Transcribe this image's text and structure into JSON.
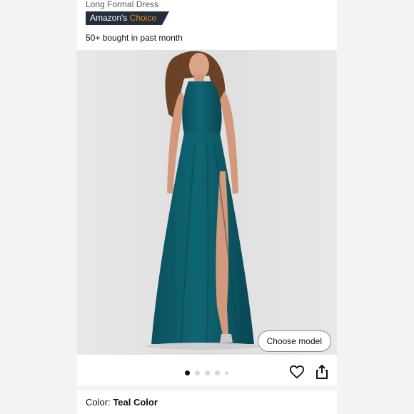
{
  "product": {
    "subtitle": "Long Formal Dress",
    "badge_prefix": "Amazon's",
    "badge_accent": "Choice",
    "bought_text": "50+ bought in past month"
  },
  "gallery": {
    "choose_model_label": "Choose model",
    "image_count": 5,
    "active_index": 0
  },
  "actions": {
    "wishlist_icon": "heart-icon",
    "share_icon": "share-icon"
  },
  "color": {
    "label": "Color:",
    "value": "Teal Color",
    "swatch_hex": "#0b5d6b"
  },
  "colors": {
    "badge_bg": "#232f3e",
    "badge_accent": "#f08804"
  }
}
